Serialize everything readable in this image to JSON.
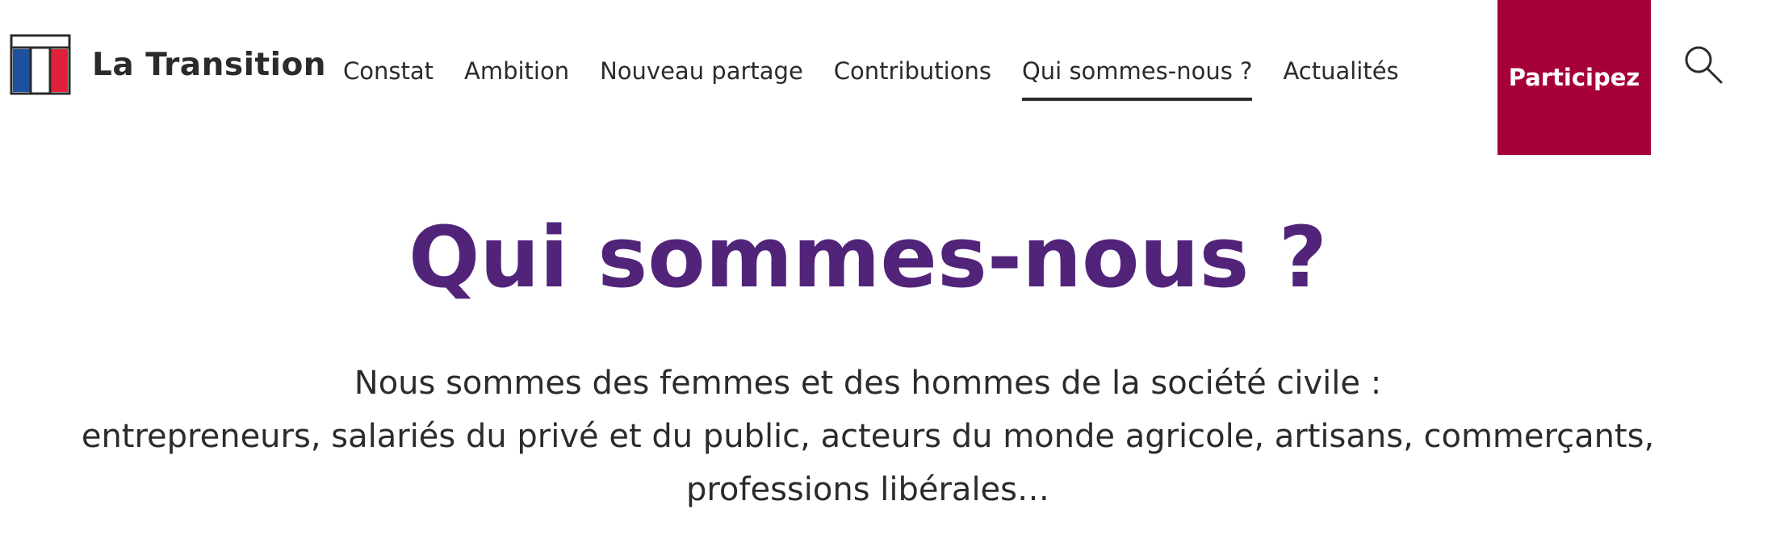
{
  "brand": {
    "name": "La Transition",
    "colors": {
      "blue": "#1e50a0",
      "red": "#e0213a",
      "accent": "#a6003a",
      "title": "#51247a"
    }
  },
  "nav": {
    "items": [
      {
        "label": "Constat",
        "active": false
      },
      {
        "label": "Ambition",
        "active": false
      },
      {
        "label": "Nouveau partage",
        "active": false
      },
      {
        "label": "Contributions",
        "active": false
      },
      {
        "label": "Qui sommes-nous ?",
        "active": true
      },
      {
        "label": "Actualités",
        "active": false
      }
    ],
    "cta_label": "Participez",
    "search_icon": "search-icon"
  },
  "hero": {
    "title": "Qui sommes-nous ?",
    "lines": [
      "Nous sommes des femmes et des hommes de la société civile :",
      "entrepreneurs, salariés du privé et du public, acteurs du monde agricole, artisans, commerçants,",
      "professions libérales…"
    ]
  }
}
